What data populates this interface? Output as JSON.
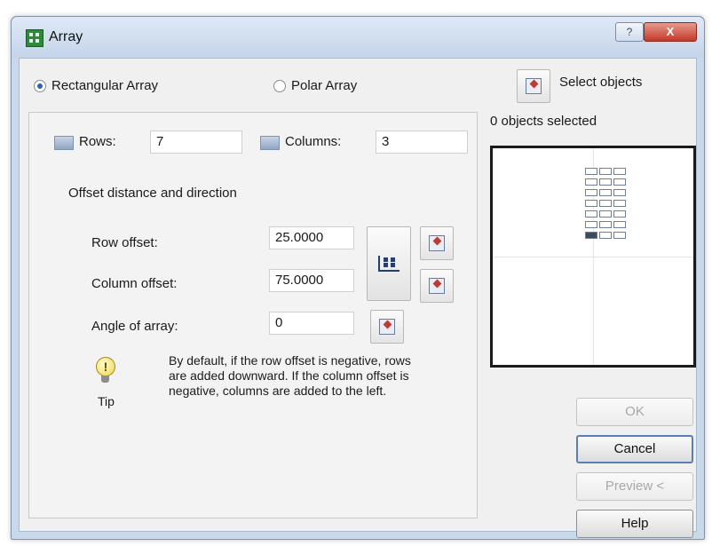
{
  "window": {
    "title": "Array"
  },
  "mode": {
    "rectangular_label": "Rectangular Array",
    "polar_label": "Polar Array",
    "selected": "rectangular"
  },
  "select": {
    "label": "Select objects",
    "status": "0 objects selected"
  },
  "rows": {
    "label": "Rows:",
    "value": "7"
  },
  "columns": {
    "label": "Columns:",
    "value": "3"
  },
  "offset": {
    "heading": "Offset distance and direction",
    "row_label": "Row offset:",
    "row_value": "25.0000",
    "column_label": "Column offset:",
    "column_value": "75.0000",
    "angle_label": "Angle of array:",
    "angle_value": "0"
  },
  "tip": {
    "label": "Tip",
    "text": "By default, if the row offset is negative, rows are added downward. If the column offset is negative, columns are added to the left."
  },
  "preview": {
    "rows": 7,
    "columns": 3
  },
  "buttons": {
    "ok": "OK",
    "cancel": "Cancel",
    "preview": "Preview <",
    "help": "Help"
  },
  "titlebar": {
    "help_glyph": "?",
    "close_glyph": "X"
  }
}
